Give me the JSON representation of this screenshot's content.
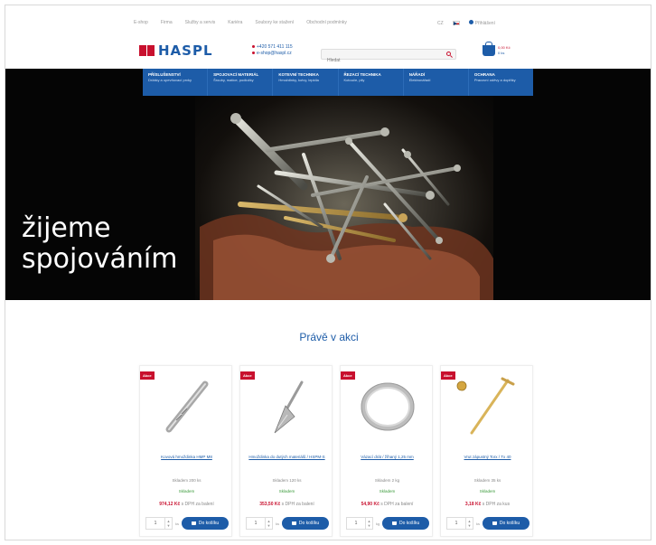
{
  "topbar": {
    "links": [
      "E-shop",
      "Firma",
      "Služby a servis",
      "Kariéra",
      "Soubory ke stažení",
      "Obchodní podmínky"
    ],
    "language": "CZ",
    "login": "Přihlášení"
  },
  "header": {
    "logo": "HASPL",
    "phone": "+420 571 411 115",
    "email": "e-shop@haspl.cz",
    "search_placeholder": "Hledat",
    "cart_price": "0,00 Kč",
    "cart_count": "0 ks"
  },
  "menu": [
    {
      "title": "Příslušenství",
      "sub": "Držáky a upevňovací prvky"
    },
    {
      "title": "Spojovací materiál",
      "sub": "Šrouby, matice, podložky"
    },
    {
      "title": "Kotevní technika",
      "sub": "Hmoždinky, kotvy, lepidla"
    },
    {
      "title": "Řezací technika",
      "sub": "Kotouče, pily"
    },
    {
      "title": "Nářadí",
      "sub": "Elektronářadí"
    },
    {
      "title": "Ochrana",
      "sub": "Pracovní oděvy a doplňky"
    }
  ],
  "hero": {
    "line1": "žijeme",
    "line2": "spojováním"
  },
  "promo": {
    "title": "Právě v akci",
    "badge": "Akce",
    "products": [
      {
        "name": "Kovová hmoždinka HMP M8",
        "stock": "Skladem 200 ks",
        "avail": "Skladem",
        "price": "974,12 Kč",
        "vat": "s DPH za balení",
        "qty": "1",
        "unit": "ks",
        "buy": "Do košíku",
        "thumb": "anchor"
      },
      {
        "name": "Hmoždinka do dutých materiálů / HSPM-S",
        "stock": "Skladem 120 ks",
        "avail": "Skladem",
        "price": "353,50 Kč",
        "vat": "s DPH za balení",
        "qty": "1",
        "unit": "ks",
        "buy": "Do košíku",
        "thumb": "spike"
      },
      {
        "name": "Vázací drát / žíhaný 1,25 mm",
        "stock": "Skladem 2 kg",
        "avail": "Skladem",
        "price": "54,90 Kč",
        "vat": "s DPH za balení",
        "qty": "1",
        "unit": "kg",
        "buy": "Do košíku",
        "thumb": "wire"
      },
      {
        "name": "Vrut zápustný Torx / Tx 40",
        "stock": "Skladem 35 ks",
        "avail": "Skladem",
        "price": "3,18 Kč",
        "vat": "s DPH za kus",
        "qty": "1",
        "unit": "ks",
        "buy": "Do košíku",
        "thumb": "screw"
      }
    ]
  },
  "colors": {
    "brand_blue": "#1d5ca8",
    "brand_red": "#c8102e",
    "avail_green": "#3a9a3a"
  }
}
